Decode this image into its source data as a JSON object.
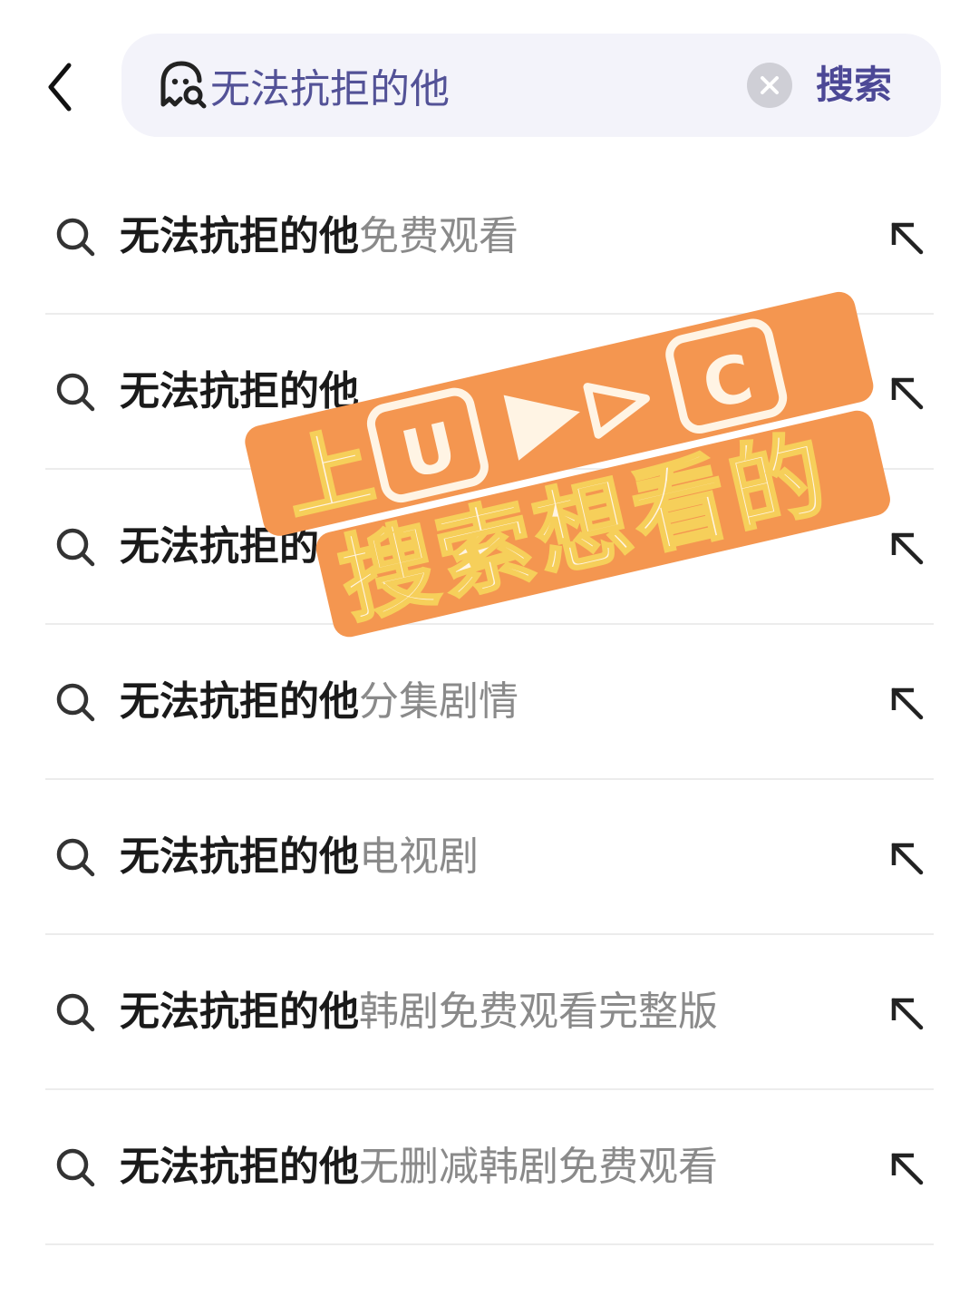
{
  "header": {
    "back_icon": "chevron-left-icon",
    "search_icon": "ghost-search-icon",
    "query": "无法抗拒的他",
    "clear_icon": "clear-x-icon",
    "search_label": "搜索",
    "colors": {
      "accent": "#4c4896",
      "query_text": "#535297",
      "box_bg": "#f3f3fa"
    }
  },
  "suggestions": [
    {
      "query": "无法抗拒的他",
      "suffix": "免费观看"
    },
    {
      "query": "无法抗拒的他",
      "suffix": ""
    },
    {
      "query": "无法抗拒的",
      "suffix": ""
    },
    {
      "query": "无法抗拒的他",
      "suffix": "分集剧情"
    },
    {
      "query": "无法抗拒的他",
      "suffix": "电视剧"
    },
    {
      "query": "无法抗拒的他",
      "suffix": "韩剧免费观看完整版"
    },
    {
      "query": "无法抗拒的他",
      "suffix": "无删减韩剧免费观看"
    }
  ],
  "overlay": {
    "line1_prefix": "上",
    "badge_u": "U",
    "badge_c": "C",
    "line2": "搜索想看的",
    "colors": {
      "orange": "#f49650",
      "cream": "#fff4e4",
      "yellow": "#f6cf5a"
    }
  }
}
